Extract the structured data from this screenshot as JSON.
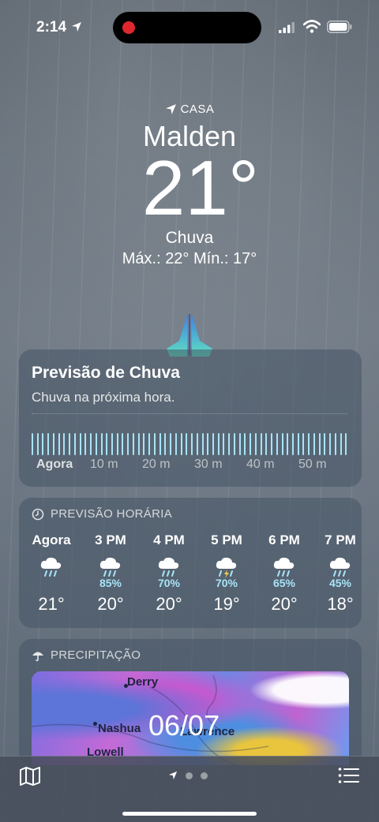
{
  "status": {
    "time": "2:14"
  },
  "header": {
    "home_label": "CASA",
    "city": "Malden",
    "temp": "21°",
    "condition": "Chuva",
    "hilo": "Máx.: 22°  Mín.: 17°"
  },
  "rain_card": {
    "title": "Previsão de Chuva",
    "subtitle": "Chuva na próxima hora.",
    "ticks": [
      "Agora",
      "10 m",
      "20 m",
      "30 m",
      "40 m",
      "50 m"
    ]
  },
  "hourly": {
    "title": "PREVISÃO HORÁRIA",
    "hours": [
      {
        "label": "Agora",
        "icon": "rain-icon",
        "pct": "",
        "temp": "21°"
      },
      {
        "label": "3 PM",
        "icon": "rain-icon",
        "pct": "85%",
        "temp": "20°"
      },
      {
        "label": "4 PM",
        "icon": "rain-icon",
        "pct": "70%",
        "temp": "20°"
      },
      {
        "label": "5 PM",
        "icon": "thunderstorm-icon",
        "pct": "70%",
        "temp": "19°"
      },
      {
        "label": "6 PM",
        "icon": "rain-icon",
        "pct": "65%",
        "temp": "20°"
      },
      {
        "label": "7 PM",
        "icon": "rain-icon",
        "pct": "45%",
        "temp": "18°"
      }
    ]
  },
  "precip": {
    "title": "PRECIPITAÇÃO",
    "places": [
      "Derry",
      "Nashua",
      "Lawrence",
      "Lowell"
    ],
    "date": "06/07"
  },
  "colors": {
    "rain_bar": "#a8e4f6",
    "card_bg": "rgba(70,84,100,0.55)"
  }
}
